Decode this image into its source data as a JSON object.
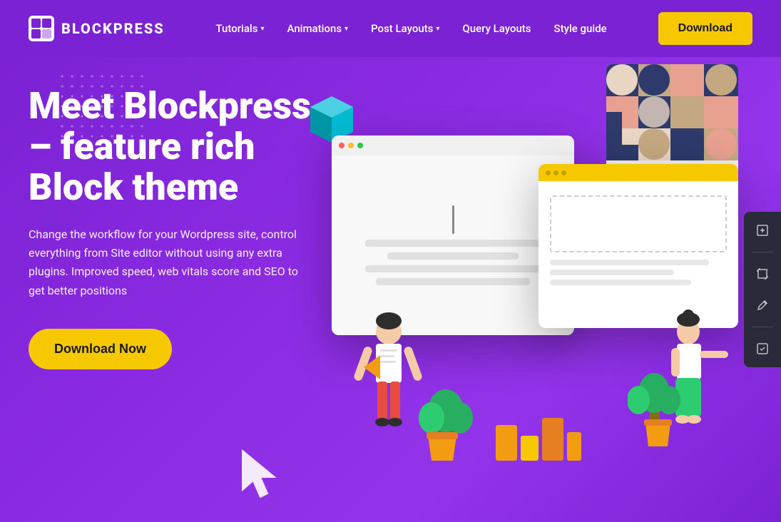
{
  "brand": {
    "name": "BLOCKPRESS",
    "logo_alt": "BlockPress Logo"
  },
  "navbar": {
    "links": [
      {
        "label": "Tutorials",
        "has_dropdown": true
      },
      {
        "label": "Animations",
        "has_dropdown": true
      },
      {
        "label": "Post Layouts",
        "has_dropdown": true
      },
      {
        "label": "Query Layouts",
        "has_dropdown": false
      },
      {
        "label": "Style guide",
        "has_dropdown": false
      }
    ],
    "cta_label": "Download"
  },
  "hero": {
    "title": "Meet Blockpress – feature rich Block theme",
    "description": "Change the workflow for your Wordpress site, control everything from Site editor without using any extra plugins. Improved speed, web vitals score and SEO to get better positions",
    "cta_label": "Download Now"
  },
  "toolbar": {
    "icons": [
      "⊹",
      "⊞",
      "✏",
      "⬡"
    ]
  },
  "colors": {
    "bg_purple": "#7B22D4",
    "cta_yellow": "#F5C800",
    "accent_teal": "#00E5C9"
  }
}
